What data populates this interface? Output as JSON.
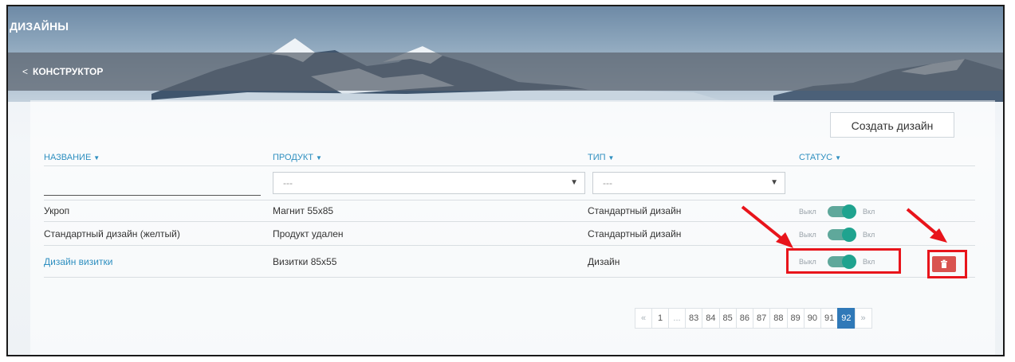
{
  "header": {
    "title": "ДИЗАЙНЫ",
    "back_label": "КОНСТРУКТОР",
    "back_icon": "chevron-left-icon"
  },
  "toolbar": {
    "create_label": "Создать дизайн"
  },
  "table": {
    "columns": [
      "НАЗВАНИЕ",
      "ПРОДУКТ",
      "ТИП",
      "СТАТУС"
    ],
    "filters": {
      "name_value": "",
      "product_value": "---",
      "type_value": "---"
    },
    "toggle_off_label": "Выкл",
    "toggle_on_label": "Вкл",
    "rows": [
      {
        "name": "Укроп",
        "product": "Магнит 55x85",
        "type": "Стандартный дизайн",
        "status": "on",
        "name_is_link": false
      },
      {
        "name": "Стандартный дизайн (желтый)",
        "product": "Продукт удален",
        "type": "Стандартный дизайн",
        "status": "on",
        "name_is_link": false
      },
      {
        "name": "Дизайн визитки",
        "product": "Визитки 85x55",
        "type": "Дизайн",
        "status": "on",
        "name_is_link": true
      }
    ],
    "row_action_icon": "trash-icon"
  },
  "pagination": {
    "prev": "«",
    "first": "1",
    "ellipsis": "...",
    "pages": [
      "83",
      "84",
      "85",
      "86",
      "87",
      "88",
      "89",
      "90",
      "91",
      "92"
    ],
    "current": "92",
    "next": "»"
  },
  "colors": {
    "accent": "#2e8fc0",
    "toggle_on": "#1fa38f",
    "danger": "#d9534f",
    "annotation": "#e8141b",
    "active_page": "#3079b8"
  }
}
